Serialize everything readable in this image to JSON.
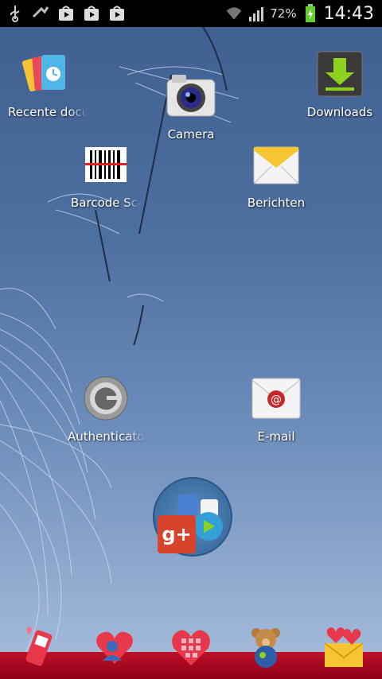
{
  "status_bar": {
    "battery_percent": "72%",
    "time": "14:43",
    "icons": [
      "usb-icon",
      "dropbox-sync-icon",
      "store-icon",
      "store-icon",
      "store-icon",
      "wifi-icon",
      "signal-icon",
      "battery-charging-icon"
    ]
  },
  "apps": {
    "recente_documenten": {
      "label": "Recente documenten",
      "icon": "recent-documents-icon"
    },
    "camera": {
      "label": "Camera",
      "icon": "camera-icon"
    },
    "downloads": {
      "label": "Downloads",
      "icon": "downloads-icon"
    },
    "barcode": {
      "label": "Barcode Scanner",
      "icon": "barcode-icon"
    },
    "berichten": {
      "label": "Berichten",
      "icon": "messages-icon"
    },
    "authenticator": {
      "label": "Authenticator",
      "icon": "authenticator-icon"
    },
    "email": {
      "label": "E-mail",
      "icon": "email-icon"
    }
  },
  "folder": {
    "icon": "google-folder-icon"
  },
  "dock": [
    {
      "icon": "phone-icon"
    },
    {
      "icon": "contacts-icon"
    },
    {
      "icon": "apps-grid-icon"
    },
    {
      "icon": "teddy-bear-icon"
    },
    {
      "icon": "love-letter-icon"
    }
  ],
  "colors": {
    "dock_bar": "#b0102a",
    "status_bar": "#000000"
  }
}
